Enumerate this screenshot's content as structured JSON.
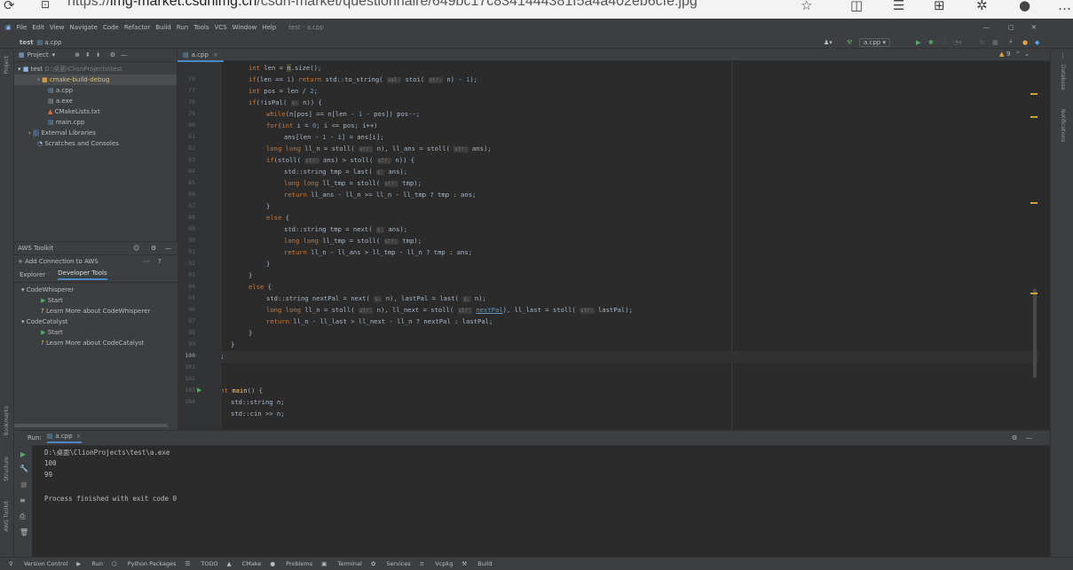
{
  "browser": {
    "url_prefix": "https://",
    "url_host": "img-market.csdnimg.cn",
    "url_path": "/csdn-market/questionnaire/649bc17c8341444381f5a4a402eb6cfe.jpg"
  },
  "menu": [
    "File",
    "Edit",
    "View",
    "Navigate",
    "Code",
    "Refactor",
    "Build",
    "Run",
    "Tools",
    "VCS",
    "Window",
    "Help"
  ],
  "window_title": "test - a.cpp",
  "breadcrumb": {
    "project": "test",
    "file": "a.cpp"
  },
  "run_config": "a.cpp",
  "project_panel": {
    "title": "Project",
    "tree": [
      {
        "label": "test",
        "hint": "D:\\桌面\\ClionProjects\\test"
      },
      {
        "label": "cmake-build-debug"
      },
      {
        "label": "a.cpp"
      },
      {
        "label": "a.exe"
      },
      {
        "label": "CMakeLists.txt"
      },
      {
        "label": "main.cpp"
      },
      {
        "label": "External Libraries"
      },
      {
        "label": "Scratches and Consoles"
      }
    ]
  },
  "aws": {
    "title": "AWS Toolkit",
    "add": "+ Add Connection to AWS",
    "tabs": [
      "Explorer",
      "Developer Tools"
    ],
    "items": [
      "CodeWhisperer",
      "Start",
      "Learn More about CodeWhisperer",
      "CodeCatalyst",
      "Start",
      "Learn More about CodeCatalyst"
    ]
  },
  "editor": {
    "tab": "a.cpp",
    "warnings": "9"
  },
  "line_numbers": [
    "",
    "76",
    "77",
    "78",
    "79",
    "80",
    "81",
    "82",
    "83",
    "84",
    "85",
    "86",
    "87",
    "88",
    "89",
    "90",
    "91",
    "92",
    "93",
    "94",
    "95",
    "96",
    "97",
    "98",
    "99",
    "100",
    "101",
    "102",
    "103",
    "104"
  ],
  "run": {
    "label": "Run:",
    "tab": "a.cpp",
    "output": [
      "D:\\桌面\\ClionProjects\\test\\a.exe",
      "100",
      "99",
      "",
      "Process finished with exit code 0"
    ]
  },
  "left_strip": [
    "Project",
    "Bookmarks",
    "Structure",
    "AWS Toolkit"
  ],
  "right_strip": [
    "Database",
    "Notifications"
  ],
  "status": [
    "Version Control",
    "Run",
    "Python Packages",
    "TODO",
    "CMake",
    "Problems",
    "Terminal",
    "Services",
    "Vcpkg",
    "Build"
  ],
  "colors": {
    "accent": "#4a88c7",
    "bg": "#2b2b2b",
    "panel": "#3c3f41"
  }
}
